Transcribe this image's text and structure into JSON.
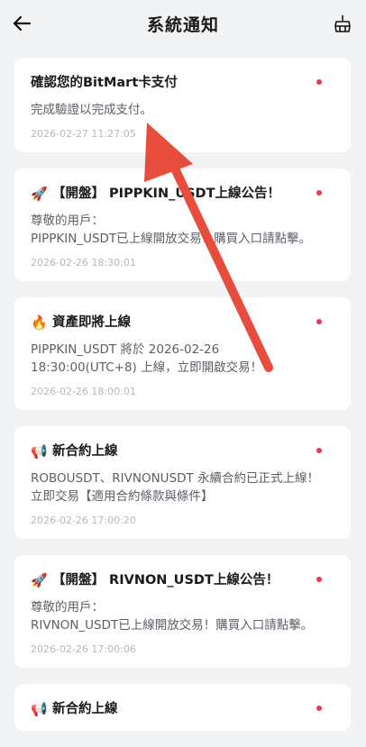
{
  "header": {
    "title": "系統通知"
  },
  "icons": {
    "back": "arrow-left-icon",
    "clear": "broom-icon"
  },
  "colors": {
    "unread_dot": "#e8375a",
    "annotation_arrow": "#e84c3d"
  },
  "notifications": [
    {
      "emoji": "",
      "title": "確認您的BitMart卡支付",
      "body": "完成驗證以完成支付。",
      "time": "2026-02-27 11:27:05",
      "unread": true
    },
    {
      "emoji": "🚀",
      "title": "【開盤】 PIPPKIN_USDT上線公告！",
      "body": "尊敬的用戶：\nPIPPKIN_USDT已上線開放交易！購買入口請點擊。",
      "time": "2026-02-26 18:30:01",
      "unread": true
    },
    {
      "emoji": "🔥",
      "title": "資產即將上線",
      "body": "PIPPKIN_USDT 將於 2026-02-26 18:30:00(UTC+8) 上線，立即開啟交易！",
      "time": "2026-02-26 18:00:01",
      "unread": true
    },
    {
      "emoji": "📢",
      "title": "新合約上線",
      "body": "ROBOUSDT、RIVNONUSDT 永續合約已正式上線！立即交易【適用合約條款與條件】",
      "time": "2026-02-26 17:00:20",
      "unread": true
    },
    {
      "emoji": "🚀",
      "title": "【開盤】 RIVNON_USDT上線公告！",
      "body": "尊敬的用戶：\nRIVNON_USDT已上線開放交易！購買入口請點擊。",
      "time": "2026-02-26 17:00:06",
      "unread": true
    },
    {
      "emoji": "📢",
      "title": "新合約上線",
      "body": "",
      "time": "",
      "unread": true
    }
  ]
}
